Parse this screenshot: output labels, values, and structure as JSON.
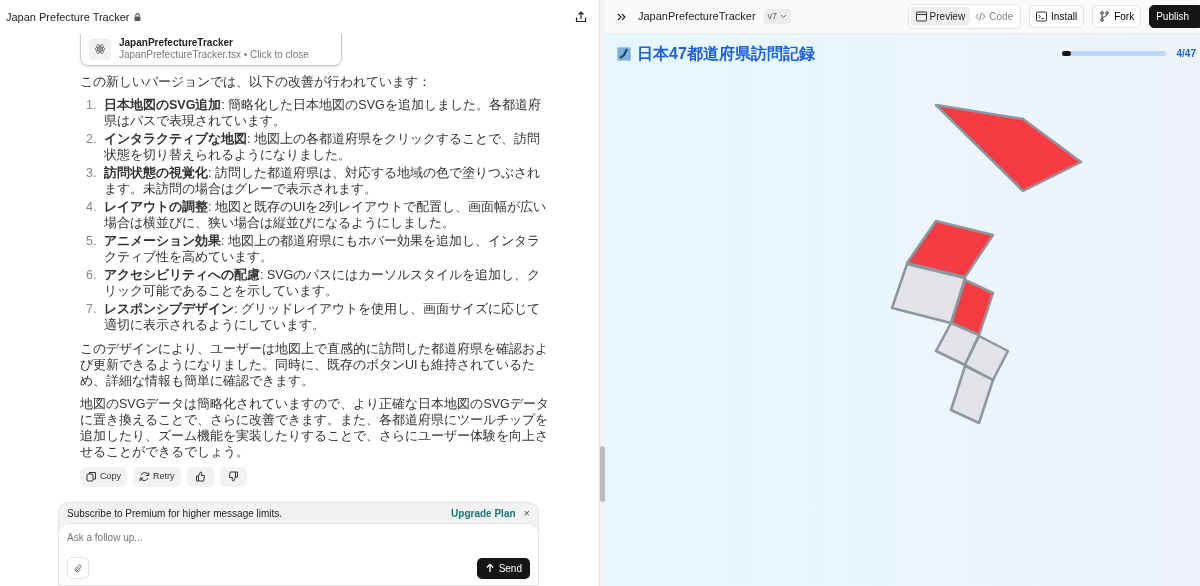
{
  "chat": {
    "title": "Japan Prefecture Tracker",
    "artifact": {
      "title": "JapanPrefectureTracker",
      "subtitle": "JapanPrefectureTracker.tsx • Click to close"
    },
    "intro": "この新しいバージョンでは、以下の改善が行われています：",
    "items": [
      {
        "number": "1.",
        "text": "**日本地図のSVG追加**: 簡略化した日本地図のSVGを追加しました。各都道府県はパスで表現されています。"
      },
      {
        "number": "2.",
        "text": "**インタラクティブな地図**: 地図上の各都道府県をクリックすることで、訪問状態を切り替えられるようになりました。"
      },
      {
        "number": "3.",
        "text": "**訪問状態の視覚化**: 訪問した都道府県は、対応する地域の色で塗りつぶされます。未訪問の場合はグレーで表示されます。"
      },
      {
        "number": "4.",
        "text": "**レイアウトの調整**: 地図と既存のUIを2列レイアウトで配置し、画面幅が広い場合は横並びに、狭い場合は縦並びになるようにしました。"
      },
      {
        "number": "5.",
        "text": "**アニメーション効果**: 地図上の都道府県にもホバー効果を追加し、インタラクティブ性を高めています。"
      },
      {
        "number": "6.",
        "text": "**アクセシビリティへの配慮**: SVGのパスにはカーソルスタイルを追加し、クリック可能であることを示しています。"
      },
      {
        "number": "7.",
        "text": "**レスポンシブデザイン**: グリッドレイアウトを使用し、画面サイズに応じて適切に表示されるようにしています。"
      }
    ],
    "paragraphs": [
      "このデザインにより、ユーザーは地図上で直感的に訪問した都道府県を確認および更新できるようになりました。同時に、既存のボタンUIも維持されているため、詳細な情報も簡単に確認できます。",
      "地図のSVGデータは簡略化されていますので、より正確な日本地図のSVGデータに置き換えることで、さらに改善できます。また、各都道府県にツールチップを追加したり、ズーム機能を実装したりすることで、さらにユーザー体験を向上させることができるでしょう。"
    ],
    "actions": [
      {
        "kind": "copy",
        "label": "Copy"
      },
      {
        "kind": "retry",
        "label": "Retry"
      },
      {
        "kind": "like"
      },
      {
        "kind": "dislike"
      }
    ],
    "banner": {
      "text": "Subscribe to Premium for higher message limits.",
      "link": "Upgrade Plan",
      "close": "×"
    },
    "composer": {
      "placeholder": "Ask a follow up...",
      "send": "Send"
    }
  },
  "preview": {
    "title": "JapanPrefectureTracker",
    "version": "v7",
    "tabs": [
      {
        "label": "Preview",
        "selected": true
      },
      {
        "label": "Code",
        "selected": false
      }
    ],
    "buttons": [
      {
        "kind": "install",
        "label": "Install"
      },
      {
        "kind": "fork",
        "label": "Fork"
      },
      {
        "kind": "publish",
        "label": "Publish"
      }
    ],
    "app": {
      "heading": "日本47都道府県訪問記録",
      "progress": {
        "level": 0.085,
        "reading": "4/47"
      },
      "prefectures": [
        {
          "visited": true
        },
        {
          "visited": true
        },
        {
          "visited": false
        },
        {
          "visited": true
        },
        {
          "visited": false
        },
        {
          "visited": false
        },
        {
          "visited": false
        }
      ]
    }
  }
}
